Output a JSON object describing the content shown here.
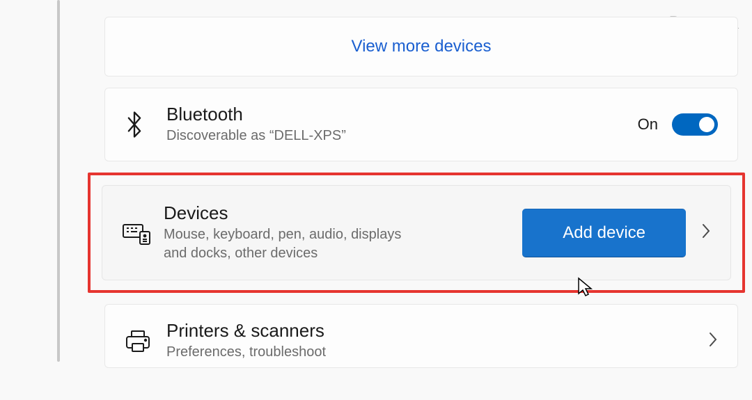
{
  "watermark": "groovyPost.com",
  "view_more": {
    "label": "View more devices"
  },
  "bluetooth": {
    "title": "Bluetooth",
    "subtitle": "Discoverable as “DELL-XPS”",
    "toggle_label": "On"
  },
  "devices": {
    "title": "Devices",
    "subtitle": "Mouse, keyboard, pen, audio, displays and docks, other devices",
    "add_button": "Add device"
  },
  "printers": {
    "title": "Printers & scanners",
    "subtitle": "Preferences, troubleshoot"
  }
}
